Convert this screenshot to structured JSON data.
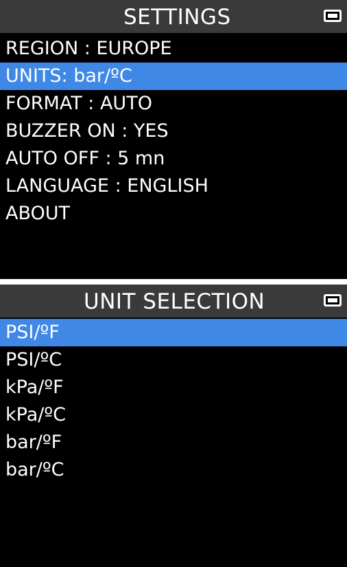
{
  "settings_screen": {
    "title": "SETTINGS",
    "battery_icon": "battery-full-icon",
    "selected_color": "#3f88e6",
    "items": [
      {
        "label": "REGION : EUROPE",
        "selected": false
      },
      {
        "label": "UNITS: bar/ºC",
        "selected": true
      },
      {
        "label": "FORMAT : AUTO",
        "selected": false
      },
      {
        "label": "BUZZER ON : YES",
        "selected": false
      },
      {
        "label": "AUTO OFF : 5 mn",
        "selected": false
      },
      {
        "label": "LANGUAGE : ENGLISH",
        "selected": false
      },
      {
        "label": "ABOUT",
        "selected": false
      }
    ]
  },
  "unit_selection_screen": {
    "title": "UNIT SELECTION",
    "battery_icon": "battery-full-icon",
    "selected_color": "#3f88e6",
    "items": [
      {
        "label": "PSI/ºF",
        "selected": true
      },
      {
        "label": "PSI/ºC",
        "selected": false
      },
      {
        "label": "kPa/ºF",
        "selected": false
      },
      {
        "label": "kPa/ºC",
        "selected": false
      },
      {
        "label": "bar/ºF",
        "selected": false
      },
      {
        "label": "bar/ºC",
        "selected": false
      }
    ]
  }
}
